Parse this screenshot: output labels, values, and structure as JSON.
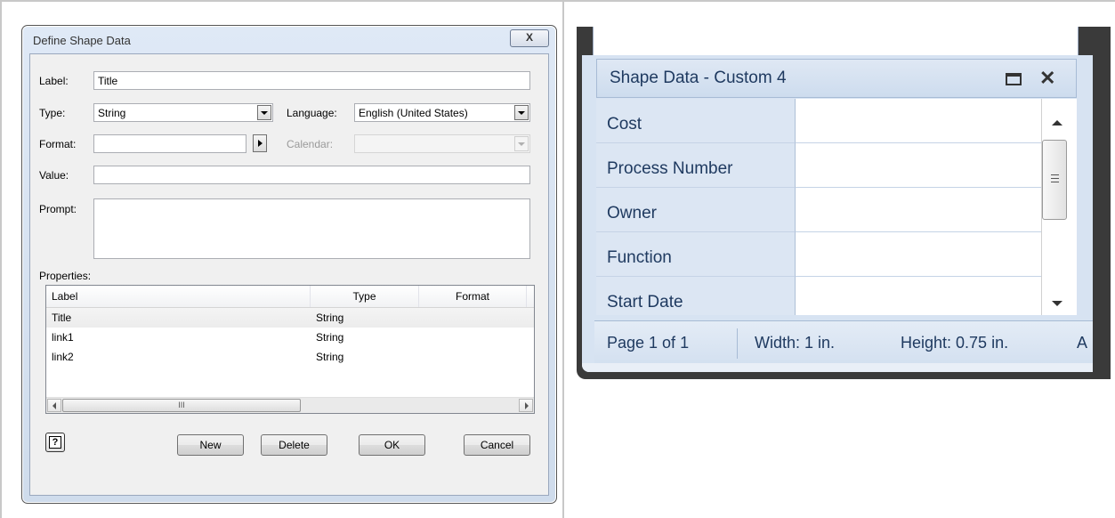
{
  "dialog": {
    "title": "Define Shape Data",
    "close_label": "X",
    "label_caption": "Label:",
    "label_value": "Title",
    "type_caption": "Type:",
    "type_value": "String",
    "language_caption": "Language:",
    "language_value": "English (United States)",
    "format_caption": "Format:",
    "format_value": "",
    "calendar_caption": "Calendar:",
    "calendar_value": "",
    "value_caption": "Value:",
    "value_value": "",
    "prompt_caption": "Prompt:",
    "prompt_value": "",
    "properties_caption": "Properties:",
    "columns": [
      "Label",
      "Type",
      "Format"
    ],
    "rows": [
      {
        "label": "Title",
        "type": "String",
        "format": "",
        "selected": true
      },
      {
        "label": "link1",
        "type": "String",
        "format": "",
        "selected": false
      },
      {
        "label": "link2",
        "type": "String",
        "format": "",
        "selected": false
      }
    ],
    "scroll_grip": "III",
    "help_icon_label": "?",
    "buttons": {
      "new": "New",
      "delete": "Delete",
      "ok": "OK",
      "cancel": "Cancel"
    }
  },
  "shape_panel": {
    "title": "Shape Data - Custom 4",
    "rows": [
      {
        "name": "Cost",
        "value": ""
      },
      {
        "name": "Process Number",
        "value": ""
      },
      {
        "name": "Owner",
        "value": ""
      },
      {
        "name": "Function",
        "value": ""
      },
      {
        "name": "Start Date",
        "value": ""
      }
    ],
    "status": {
      "page": "Page 1 of 1",
      "width": "Width: 1 in.",
      "height": "Height: 0.75 in.",
      "more": "A"
    }
  },
  "colors": {
    "panel_text": "#1f3a60",
    "panel_header_bg": "#dce6f3",
    "dialog_frame": "#cfdcec"
  }
}
